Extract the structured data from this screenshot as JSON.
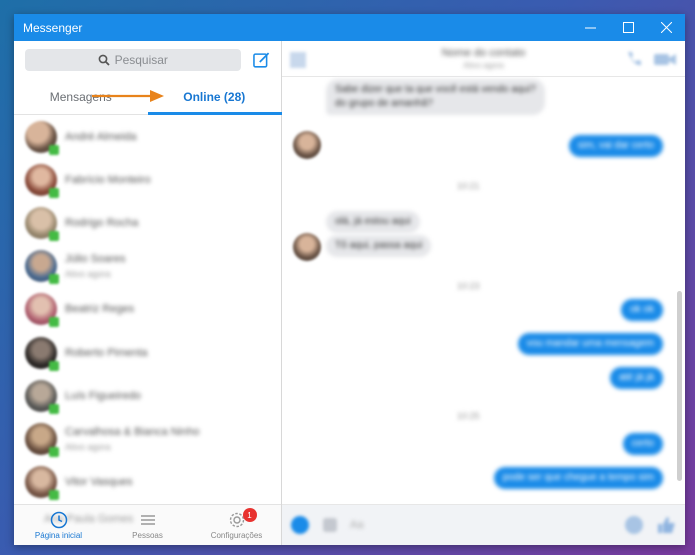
{
  "window": {
    "title": "Messenger"
  },
  "search": {
    "placeholder": "Pesquisar"
  },
  "tabs": [
    {
      "label": "Mensagens",
      "active": false
    },
    {
      "label": "Online (28)",
      "active": true
    }
  ],
  "contacts": [
    {
      "name": "André Almeida",
      "sub": ""
    },
    {
      "name": "Fabrício Monteiro",
      "sub": ""
    },
    {
      "name": "Rodrigo Rocha",
      "sub": ""
    },
    {
      "name": "Júlio Soares",
      "sub": "Ativo agora"
    },
    {
      "name": "Beatriz Reges",
      "sub": ""
    },
    {
      "name": "Roberto Pimenta",
      "sub": ""
    },
    {
      "name": "Luís Figueiredo",
      "sub": ""
    },
    {
      "name": "Carvalhosa & Bianca Ninho",
      "sub": "Ativo agora"
    },
    {
      "name": "Vitor Vasques",
      "sub": ""
    }
  ],
  "bottom_nav": {
    "home_label": "Página inicial",
    "people_label": "Pessoas",
    "settings_label": "Configurações",
    "settings_badge": "1",
    "ghost_text": "Ana Paula Gomes"
  },
  "chat": {
    "title": "Nome do contato",
    "subtitle": "Ativo agora",
    "messages": [
      {
        "dir": "in",
        "text": "Sabe dizer que ta que você está vendo aqui?"
      },
      {
        "dir": "in",
        "text": "do grupo de amanhã?"
      },
      {
        "dir": "out",
        "text": "sim, vai dar certo"
      },
      {
        "dir": "stamp",
        "text": "10:21"
      },
      {
        "dir": "in",
        "text": "olá, já estou aqui"
      },
      {
        "dir": "in",
        "text": "Tô aqui, passa aqui"
      },
      {
        "dir": "stamp",
        "text": "10:23"
      },
      {
        "dir": "out",
        "text": "ok ok"
      },
      {
        "dir": "out",
        "text": "vou mandar uma mensagem"
      },
      {
        "dir": "out",
        "text": "até já já"
      },
      {
        "dir": "stamp",
        "text": "10:25"
      },
      {
        "dir": "out",
        "text": "certo"
      },
      {
        "dir": "out",
        "text": "pode ser que chegue a tempo sim"
      }
    ],
    "composer_placeholder": "Aa"
  },
  "colors": {
    "brand": "#1a8be8",
    "accent_text": "#1877d2",
    "online": "#44bb44",
    "badge": "#e8322f",
    "arrow": "#e8831b"
  }
}
